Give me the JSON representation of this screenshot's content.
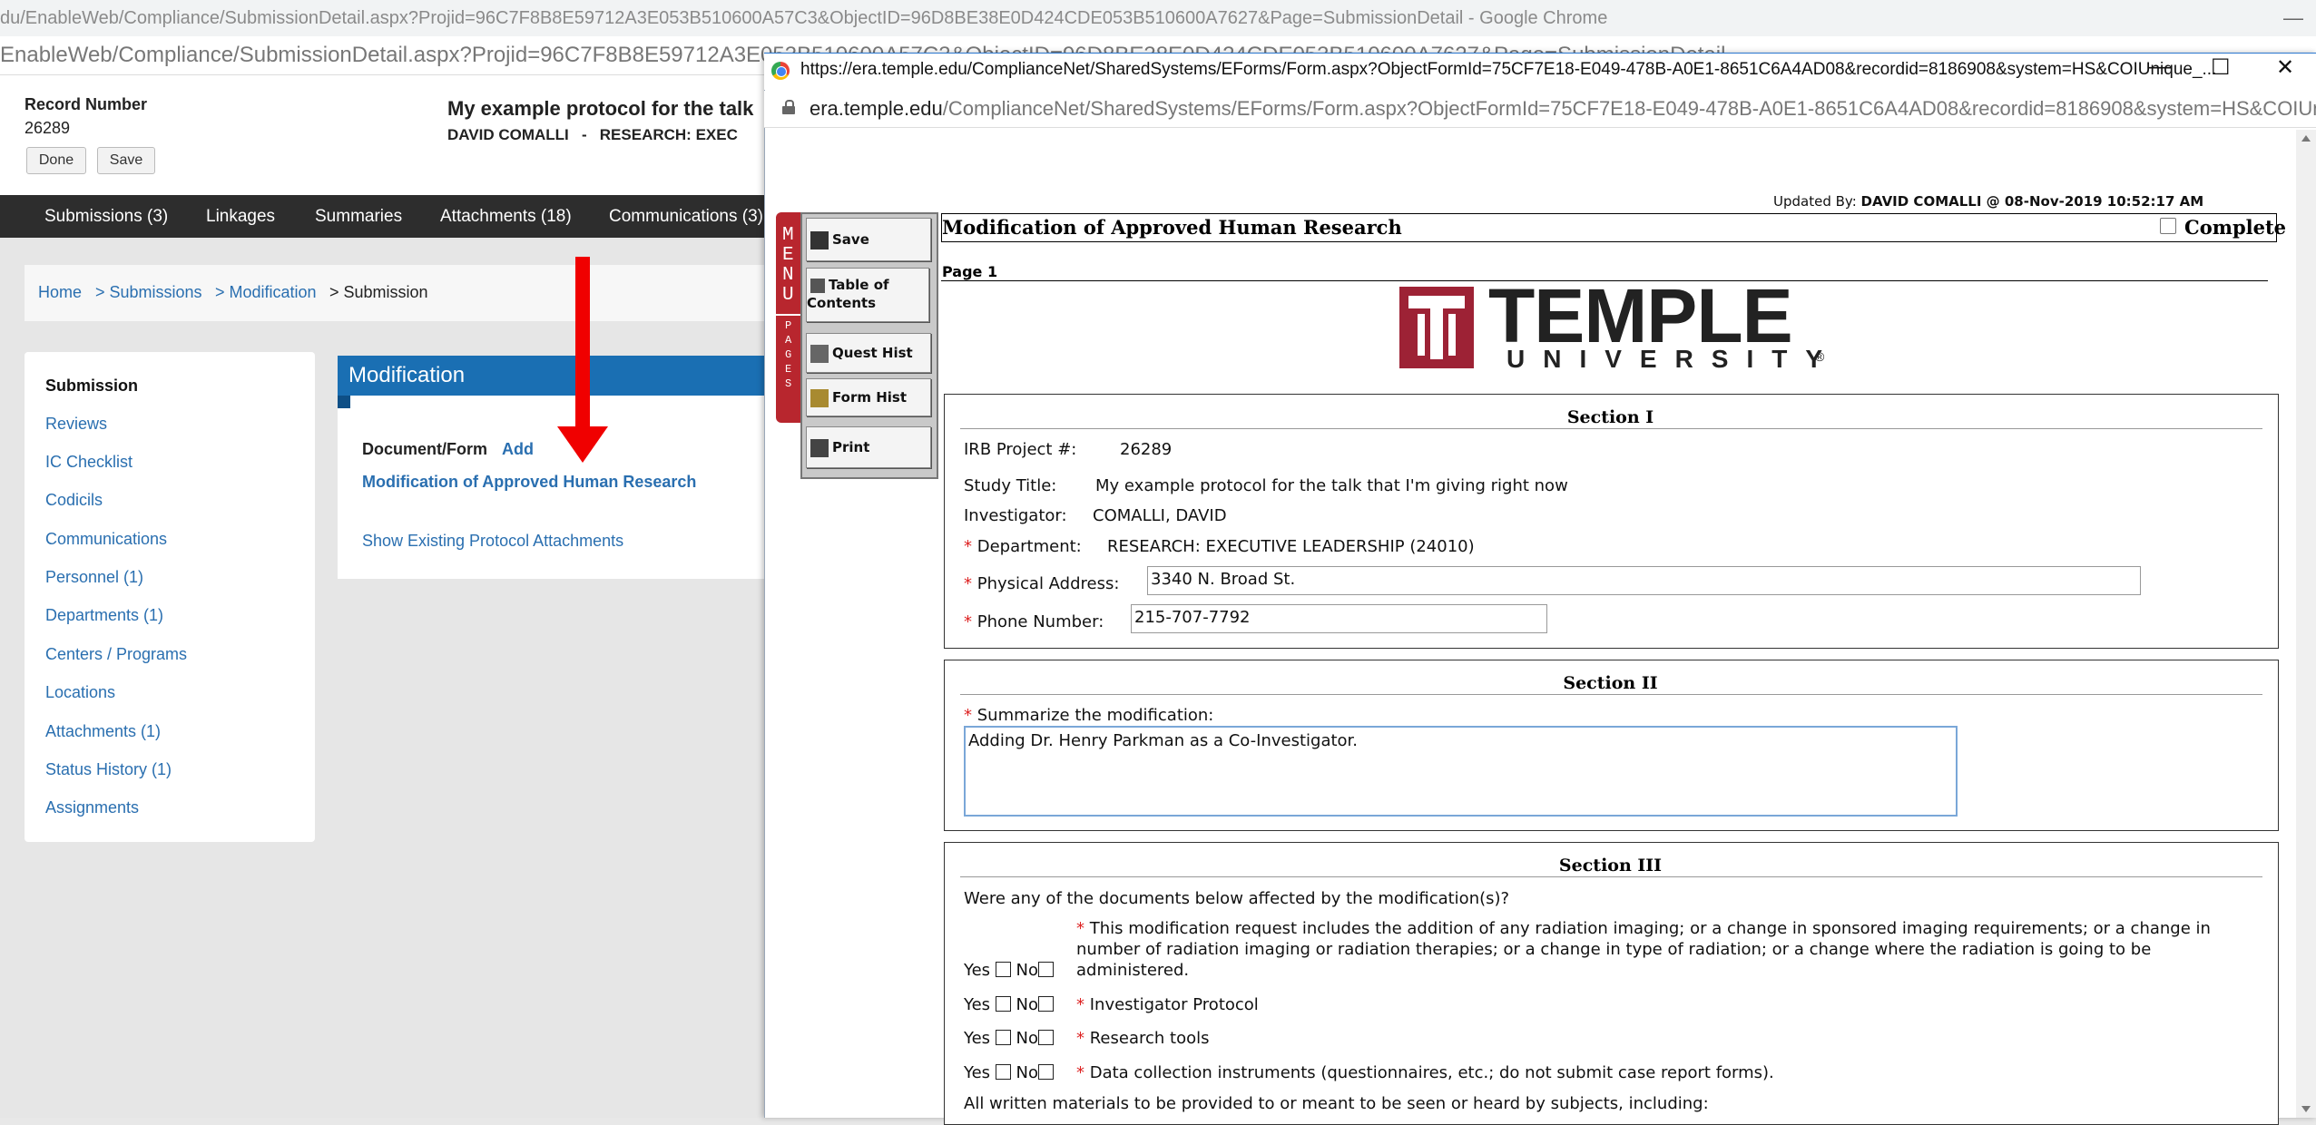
{
  "bg_window": {
    "title": "du/EnableWeb/Compliance/SubmissionDetail.aspx?Projid=96C7F8B8E59712A3E053B510600A57C3&ObjectID=96D8BE38E0D424CDE053B510600A7627&Page=SubmissionDetail - Google Chrome",
    "url": "EnableWeb/Compliance/SubmissionDetail.aspx?Projid=96C7F8B8E59712A3E053B510600A57C3&ObjectID=96D8BE38E0D424CDE053B510600A7627&Page=SubmissionDetail",
    "minimize": "—"
  },
  "record": {
    "label": "Record Number",
    "number": "26289",
    "done_label": "Done",
    "save_label": "Save",
    "protocol_title": "My example protocol for the talk",
    "protocol_sub": "DAVID COMALLI   -   RESEARCH: EXEC"
  },
  "nav": [
    "Submissions (3)",
    "Linkages",
    "Summaries",
    "Attachments (18)",
    "Communications (3)"
  ],
  "breadcrumb": {
    "home": "Home",
    "submissions": "> Submissions",
    "modification": "> Modification",
    "submission": "> Submission"
  },
  "sidebar": {
    "title": "Submission",
    "items": [
      "Reviews",
      "IC Checklist",
      "Codicils",
      "Communications",
      "Personnel (1)",
      "Departments (1)",
      "Centers / Programs",
      "Locations",
      "Attachments (1)",
      "Status History (1)",
      "Assignments"
    ]
  },
  "modification_panel": {
    "title": "Modification",
    "doc_label": "Document/Form",
    "add_label": "Add",
    "form_link": "Modification of Approved Human Research",
    "show_attachments": "Show Existing Protocol Attachments"
  },
  "popup": {
    "title": "https://era.temple.edu/ComplianceNet/SharedSystems/EForms/Form.aspx?ObjectFormId=75CF7E18-E049-478B-A0E1-8651C6A4AD08&recordid=8186908&system=HS&COIUnique_...",
    "url_host": "era.temple.edu",
    "url_path": "/ComplianceNet/SharedSystems/EForms/Form.aspx?ObjectFormId=75CF7E18-E049-478B-A0E1-8651C6A4AD08&recordid=8186908&system=HS&COIUnique...",
    "ctl_min": "—",
    "ctl_max": "☐",
    "ctl_close": "✕"
  },
  "menu": {
    "tab_menu": [
      "M",
      "E",
      "N",
      "U"
    ],
    "tab_pages": [
      "P",
      "A",
      "G",
      "E",
      "S"
    ],
    "save": "Save",
    "toc": "Table of Contents",
    "quest_hist": "Quest Hist",
    "form_hist": "Form Hist",
    "print": "Print"
  },
  "form": {
    "updated_label": "Updated By:",
    "updated_value": "DAVID COMALLI @ 08-Nov-2019 10:52:17 AM",
    "title": "Modification of Approved Human Research",
    "complete_label": "Complete",
    "page_label": "Page 1",
    "logo_main": "TEMPLE",
    "logo_sub": "UNIVERSITY",
    "logo_reg": "®",
    "required_mark": "*",
    "section1": {
      "title": "Section I",
      "irb_label": "IRB Project #:",
      "irb_value": "26289",
      "study_label": "Study Title:",
      "study_value": "My example protocol for the talk that I'm giving right now",
      "investigator_label": "Investigator:",
      "investigator_value": "COMALLI, DAVID",
      "department_label": "Department:",
      "department_value": "RESEARCH: EXECUTIVE LEADERSHIP (24010)",
      "address_label": "Physical Address:",
      "address_value": "3340 N. Broad St.",
      "phone_label": "Phone Number:",
      "phone_value": "215-707-7792"
    },
    "section2": {
      "title": "Section II",
      "summary_label": "Summarize the modification:",
      "summary_value": "Adding Dr. Henry Parkman as a Co-Investigator."
    },
    "section3": {
      "title": "Section III",
      "question": "Were any of the documents below affected by the modification(s)?",
      "yes": "Yes",
      "no": "No",
      "radiation_line1": "This modification request includes the addition of any radiation imaging; or a change in sponsored imaging requirements; or a change in",
      "radiation_line2": "number of radiation imaging or radiation therapies; or a change in type of radiation; or a change where the radiation is going to be",
      "radiation_line3": "administered.",
      "item_protocol": "Investigator Protocol",
      "item_tools": "Research tools",
      "item_instruments": "Data collection instruments (questionnaires, etc.; do not submit case report forms).",
      "written": "All written materials to be provided to or meant to be seen or heard by subjects, including:"
    }
  }
}
